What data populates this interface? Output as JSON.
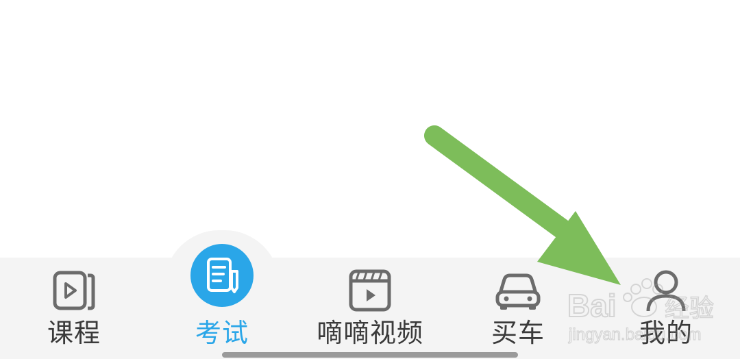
{
  "tabbar": {
    "items": [
      {
        "id": "course",
        "label": "课程",
        "icon": "play-book-icon",
        "active": false
      },
      {
        "id": "exam",
        "label": "考试",
        "icon": "exam-edit-icon",
        "active": true
      },
      {
        "id": "video",
        "label": "嘀嘀视频",
        "icon": "video-clapper-icon",
        "active": false
      },
      {
        "id": "car",
        "label": "买车",
        "icon": "car-icon",
        "active": false
      },
      {
        "id": "me",
        "label": "我的",
        "icon": "user-icon",
        "active": false
      }
    ]
  },
  "colors": {
    "accent": "#2aa6e8",
    "tab_text": "#3a3a3a",
    "icon_gray": "#6b6b6b",
    "tabbar_bg": "#f4f4f4",
    "annotation_arrow": "#7dbd5a"
  },
  "watermark": {
    "brand": "Bai",
    "brand_suffix": "经验",
    "url": "jingyan.baidu.com"
  }
}
